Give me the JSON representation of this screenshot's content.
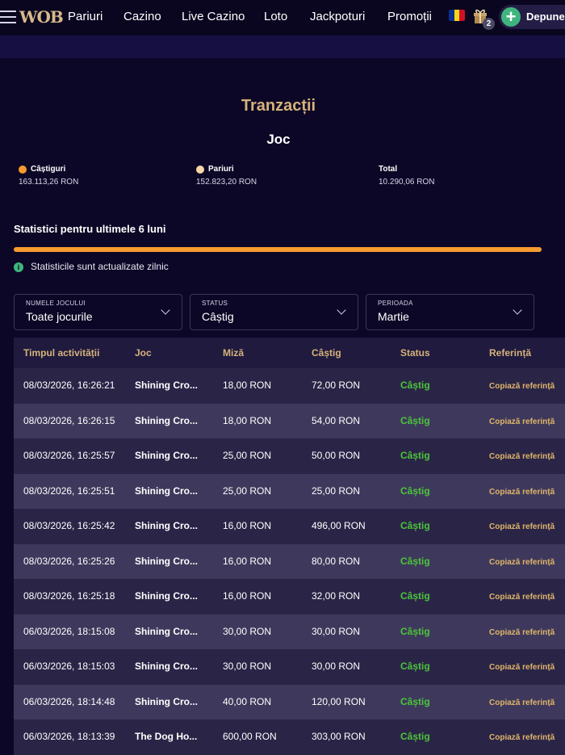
{
  "header": {
    "logo": "WOB",
    "nav": [
      "Pariuri",
      "Cazino",
      "Live Cazino",
      "Loto",
      "Jackpoturi",
      "Promoții"
    ],
    "gift_count": "2",
    "deposit_label": "Depune",
    "flag_colors": [
      "#0a2f8f",
      "#f9d616",
      "#ce1126"
    ]
  },
  "page": {
    "title": "Tranzacții",
    "subtitle": "Joc"
  },
  "summary": {
    "wins": {
      "label": "Câștiguri",
      "value": "163.113,26 RON",
      "color": "#f59b2f"
    },
    "bets": {
      "label": "Pariuri",
      "value": "152.823,20 RON",
      "color": "#f7d7a8"
    },
    "total": {
      "label": "Total",
      "value": "10.290,06 RON"
    }
  },
  "stats": {
    "heading": "Statistici pentru ultimele 6 luni",
    "progress_fraction": 1.0,
    "info": "Statisticile sunt actualizate zilnic"
  },
  "filters": [
    {
      "label": "NUMELE JOCULUI",
      "value": "Toate jocurile"
    },
    {
      "label": "STATUS",
      "value": "Câștig"
    },
    {
      "label": "PERIOADA",
      "value": "Martie"
    }
  ],
  "table": {
    "headers": [
      "Timpul activității",
      "Joc",
      "Miză",
      "Câștig",
      "Status",
      "Referință"
    ],
    "rows": [
      {
        "time": "08/03/2026, 16:26:21",
        "game": "Shining Cro...",
        "stake": "18,00 RON",
        "win": "72,00 RON",
        "status": "Câștig",
        "ref": "Copiază referință"
      },
      {
        "time": "08/03/2026, 16:26:15",
        "game": "Shining Cro...",
        "stake": "18,00 RON",
        "win": "54,00 RON",
        "status": "Câștig",
        "ref": "Copiază referință"
      },
      {
        "time": "08/03/2026, 16:25:57",
        "game": "Shining Cro...",
        "stake": "25,00 RON",
        "win": "50,00 RON",
        "status": "Câștig",
        "ref": "Copiază referință"
      },
      {
        "time": "08/03/2026, 16:25:51",
        "game": "Shining Cro...",
        "stake": "25,00 RON",
        "win": "25,00 RON",
        "status": "Câștig",
        "ref": "Copiază referință"
      },
      {
        "time": "08/03/2026, 16:25:42",
        "game": "Shining Cro...",
        "stake": "16,00 RON",
        "win": "496,00 RON",
        "status": "Câștig",
        "ref": "Copiază referință"
      },
      {
        "time": "08/03/2026, 16:25:26",
        "game": "Shining Cro...",
        "stake": "16,00 RON",
        "win": "80,00 RON",
        "status": "Câștig",
        "ref": "Copiază referință"
      },
      {
        "time": "08/03/2026, 16:25:18",
        "game": "Shining Cro...",
        "stake": "16,00 RON",
        "win": "32,00 RON",
        "status": "Câștig",
        "ref": "Copiază referință"
      },
      {
        "time": "06/03/2026, 18:15:08",
        "game": "Shining Cro...",
        "stake": "30,00 RON",
        "win": "30,00 RON",
        "status": "Câștig",
        "ref": "Copiază referință"
      },
      {
        "time": "06/03/2026, 18:15:03",
        "game": "Shining Cro...",
        "stake": "30,00 RON",
        "win": "30,00 RON",
        "status": "Câștig",
        "ref": "Copiază referință"
      },
      {
        "time": "06/03/2026, 18:14:48",
        "game": "Shining Cro...",
        "stake": "40,00 RON",
        "win": "120,00 RON",
        "status": "Câștig",
        "ref": "Copiază referință"
      },
      {
        "time": "06/03/2026, 18:13:39",
        "game": "The Dog Ho...",
        "stake": "600,00 RON",
        "win": "303,00 RON",
        "status": "Câștig",
        "ref": "Copiază referință"
      }
    ]
  }
}
